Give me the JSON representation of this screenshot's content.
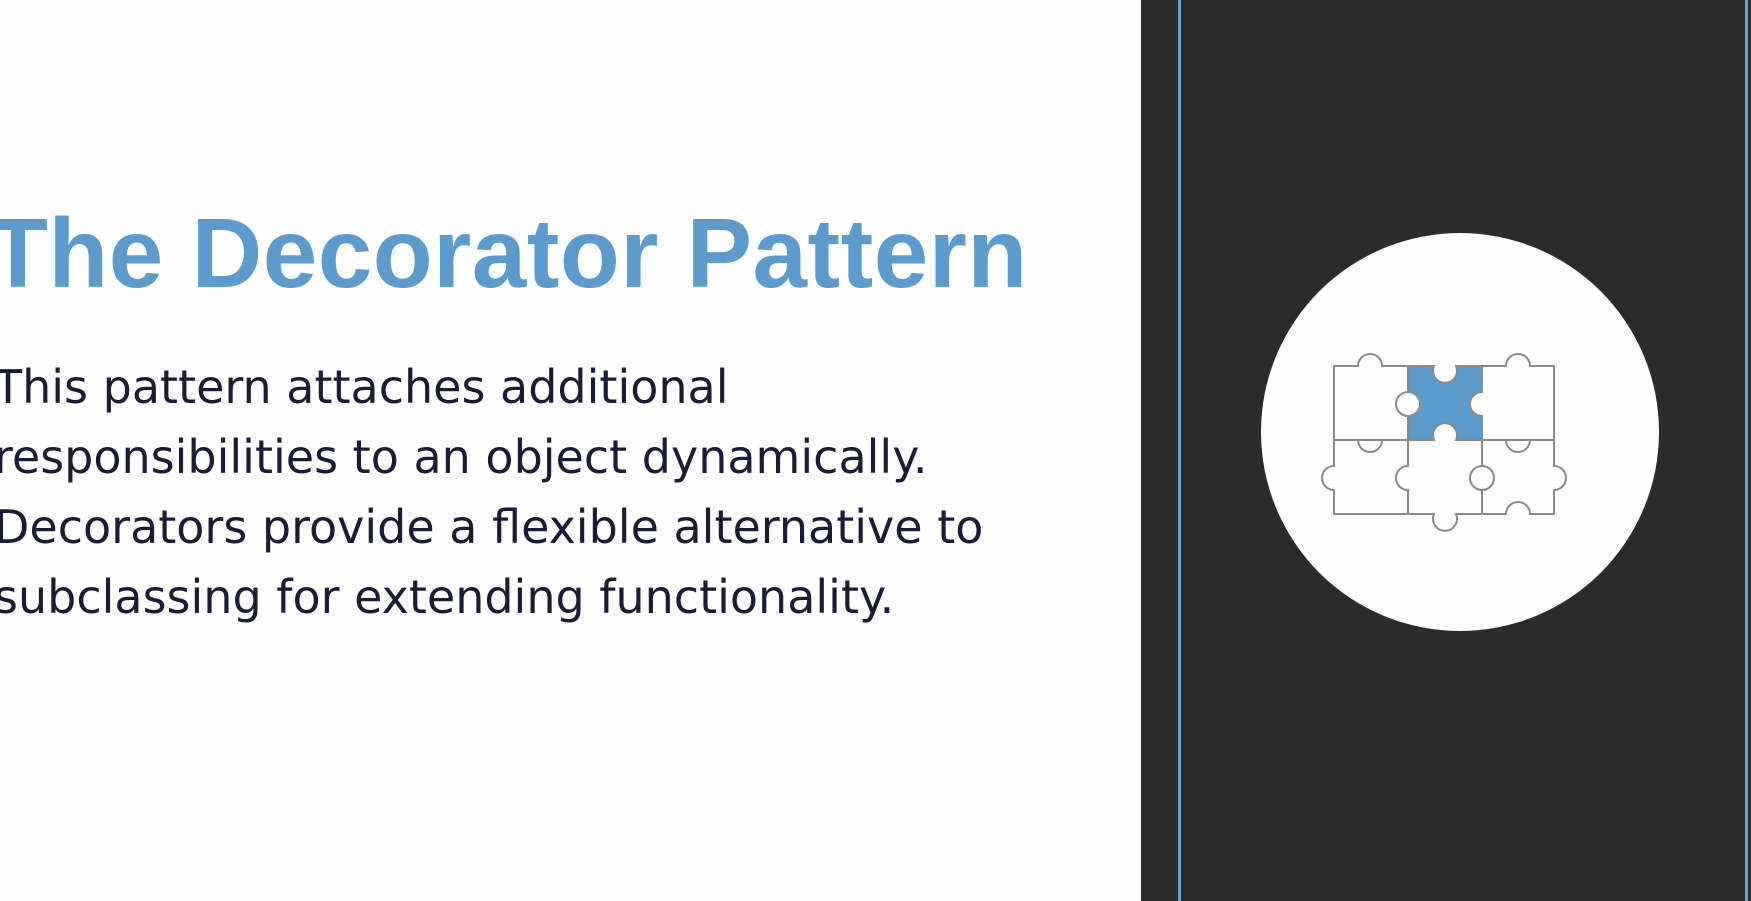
{
  "slide": {
    "title": "The Decorator Pattern",
    "body_lines": [
      "This pattern attaches additional",
      "responsibilities to an object dynamically.",
      "Decorators provide a flexible alternative to",
      "subclassing for extending functionality."
    ]
  },
  "illustration": {
    "icon": "puzzle-pieces-icon",
    "highlighted_piece": "top-center"
  },
  "colors": {
    "background": "#fdfdfd",
    "title": "#5d9bcc",
    "body_text": "#1b1b33",
    "panel": "#2b2b2b",
    "accent_line": "#6a9fd0",
    "circle": "#fdfdfd",
    "puzzle_outline": "#8a8a8a",
    "puzzle_highlight": "#5d9bcc"
  }
}
